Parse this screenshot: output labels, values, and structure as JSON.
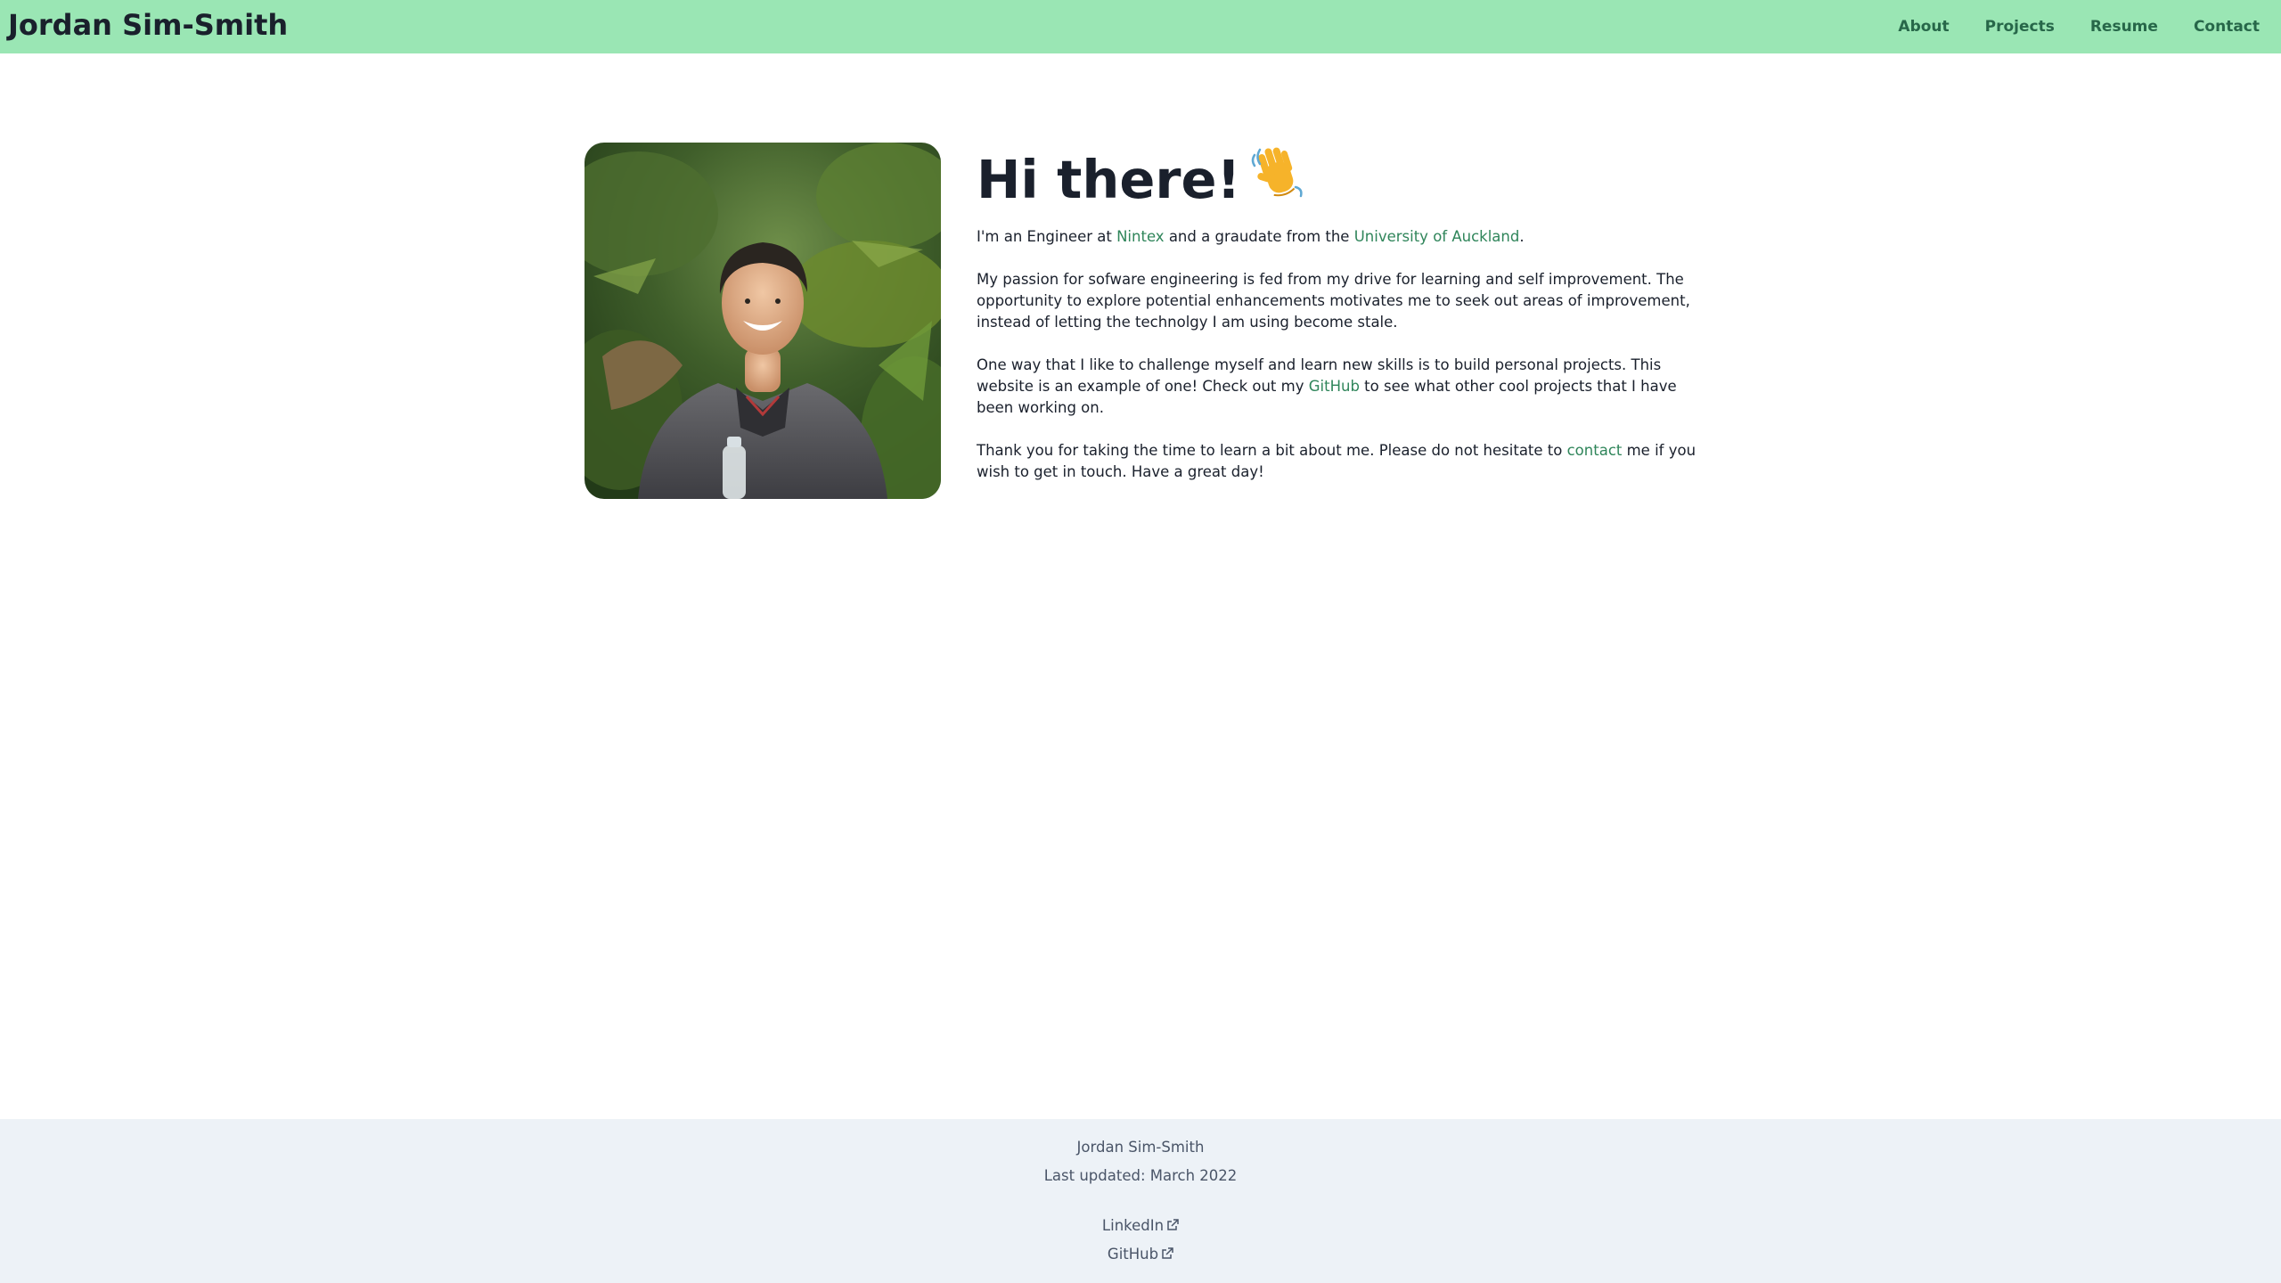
{
  "header": {
    "brand": "Jordan Sim-Smith",
    "nav": [
      "About",
      "Projects",
      "Resume",
      "Contact"
    ]
  },
  "intro": {
    "heading": "Hi there!",
    "heading_emoji": "waving-hand-icon",
    "p1": {
      "t1": "I'm an Engineer at ",
      "link1": "Nintex",
      "t2": " and a graudate from the ",
      "link2": "University of Auckland",
      "t3": "."
    },
    "p2": "My passion for sofware engineering is fed from my drive for learning and self improvement. The opportunity to explore potential enhancements motivates me to seek out areas of improvement, instead of letting the technolgy I am using become stale.",
    "p3": {
      "t1": "One way that I like to challenge myself and learn new skills is to build personal projects. This website is an example of one! Check out my ",
      "link": "GitHub",
      "t2": " to see what other cool projects that I have been working on."
    },
    "p4": {
      "t1": "Thank you for taking the time to learn a bit about me. Please do not hesitate to ",
      "link": "contact",
      "t2": " me if you wish to get in touch. Have a great day!"
    }
  },
  "footer": {
    "name": "Jordan Sim-Smith",
    "updated": "Last updated: March 2022",
    "links": [
      "LinkedIn",
      "GitHub"
    ]
  },
  "colors": {
    "header_bg": "#9ae6b4",
    "link": "#2f855a",
    "nav_link": "#276749",
    "footer_bg": "#edf2f7"
  }
}
